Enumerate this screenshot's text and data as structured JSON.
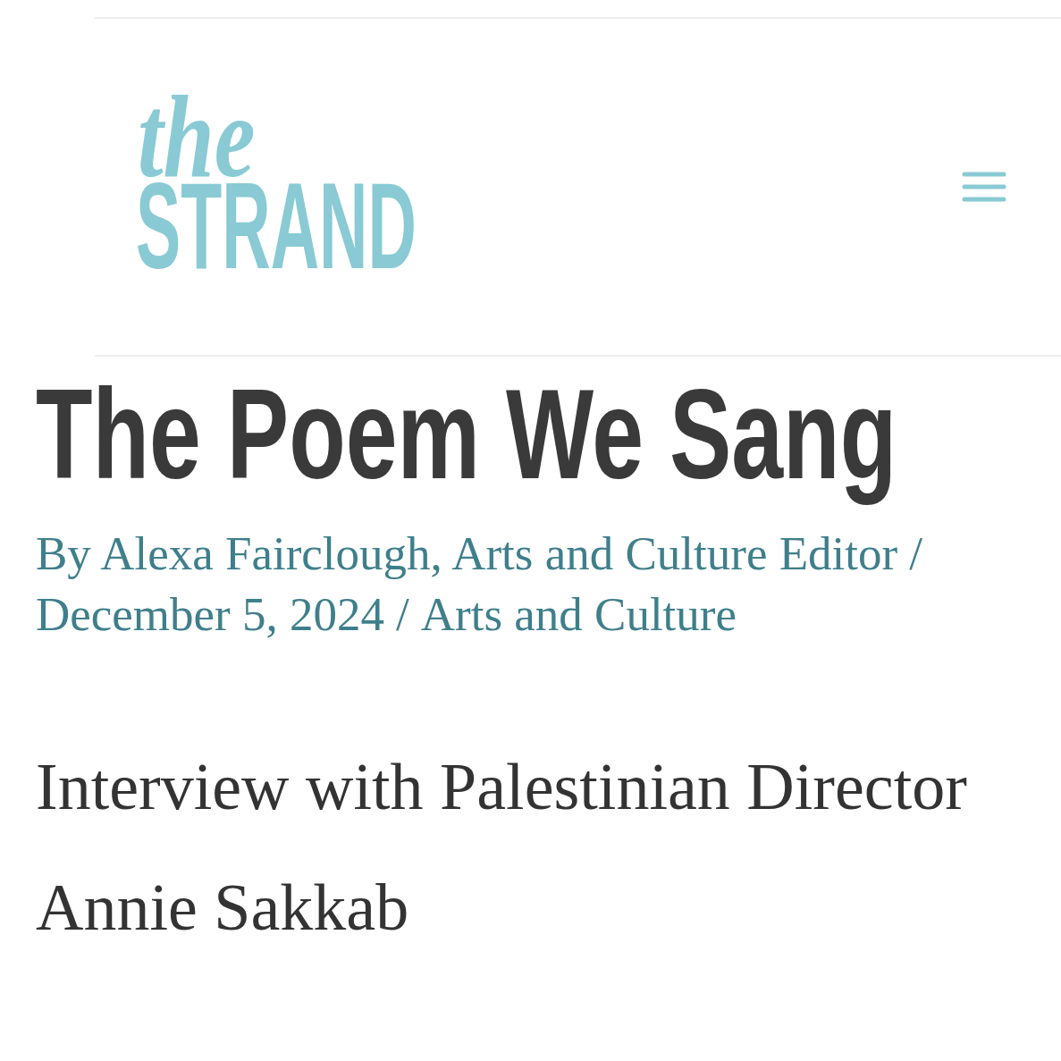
{
  "header": {
    "logo": {
      "script": "the",
      "wordmark": "STRAND"
    }
  },
  "article": {
    "title": "The Poem We Sang",
    "meta": {
      "byline": "By Alexa Fairclough, Arts and Culture Editor",
      "date": "December 5, 2024",
      "category": "Arts and Culture",
      "separators": [
        "/",
        "/"
      ]
    },
    "subtitle": "Interview with Palestinian Director Annie Sakkab"
  }
}
